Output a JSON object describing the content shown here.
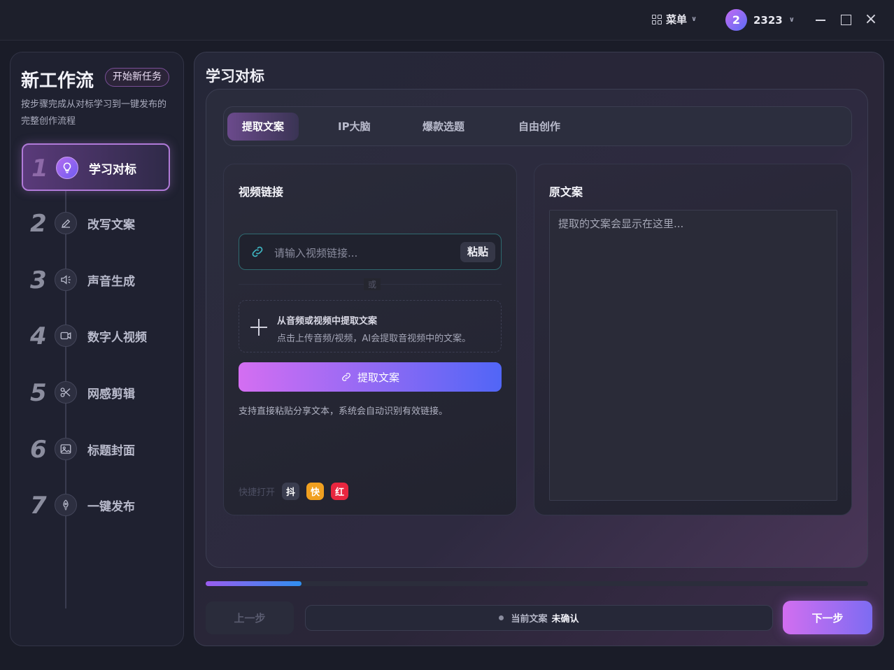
{
  "titlebar": {
    "menu_label": "菜单",
    "user_avatar": "2",
    "user_name": "2323"
  },
  "sidebar": {
    "title": "新工作流",
    "new_task_label": "开始新任务",
    "description": "按步骤完成从对标学习到一键发布的完整创作流程",
    "steps": [
      {
        "num": "1",
        "label": "学习对标",
        "icon": "lightbulb-icon",
        "active": true
      },
      {
        "num": "2",
        "label": "改写文案",
        "icon": "pen-icon",
        "active": false
      },
      {
        "num": "3",
        "label": "声音生成",
        "icon": "speaker-icon",
        "active": false
      },
      {
        "num": "4",
        "label": "数字人视频",
        "icon": "video-camera-icon",
        "active": false
      },
      {
        "num": "5",
        "label": "网感剪辑",
        "icon": "scissors-icon",
        "active": false
      },
      {
        "num": "6",
        "label": "标题封面",
        "icon": "image-icon",
        "active": false
      },
      {
        "num": "7",
        "label": "一键发布",
        "icon": "rocket-icon",
        "active": false
      }
    ]
  },
  "main": {
    "title": "学习对标",
    "tabs": [
      {
        "label": "提取文案",
        "active": true
      },
      {
        "label": "IP大脑",
        "active": false
      },
      {
        "label": "爆款选题",
        "active": false
      },
      {
        "label": "自由创作",
        "active": false
      }
    ],
    "left_card": {
      "title": "视频链接",
      "url_placeholder": "请输入视频链接...",
      "paste_label": "粘贴",
      "or_label": "或",
      "upload_title": "从音频或视频中提取文案",
      "upload_desc": "点击上传音频/视频，AI会提取音视频中的文案。",
      "extract_label": "提取文案",
      "hint": "支持直接粘贴分享文本，系统会自动识别有效链接。",
      "quick_label": "快捷打开",
      "quick_items": [
        "抖",
        "快",
        "红"
      ]
    },
    "right_card": {
      "title": "原文案",
      "placeholder": "提取的文案会显示在这里..."
    },
    "progress": 0.145,
    "prev_label": "上一步",
    "status_label": "当前文案",
    "status_value": "未确认",
    "next_label": "下一步"
  },
  "colors": {
    "accent_start": "#d46ef2",
    "accent_end": "#5166f6",
    "app_bg": "#1a1c28"
  }
}
